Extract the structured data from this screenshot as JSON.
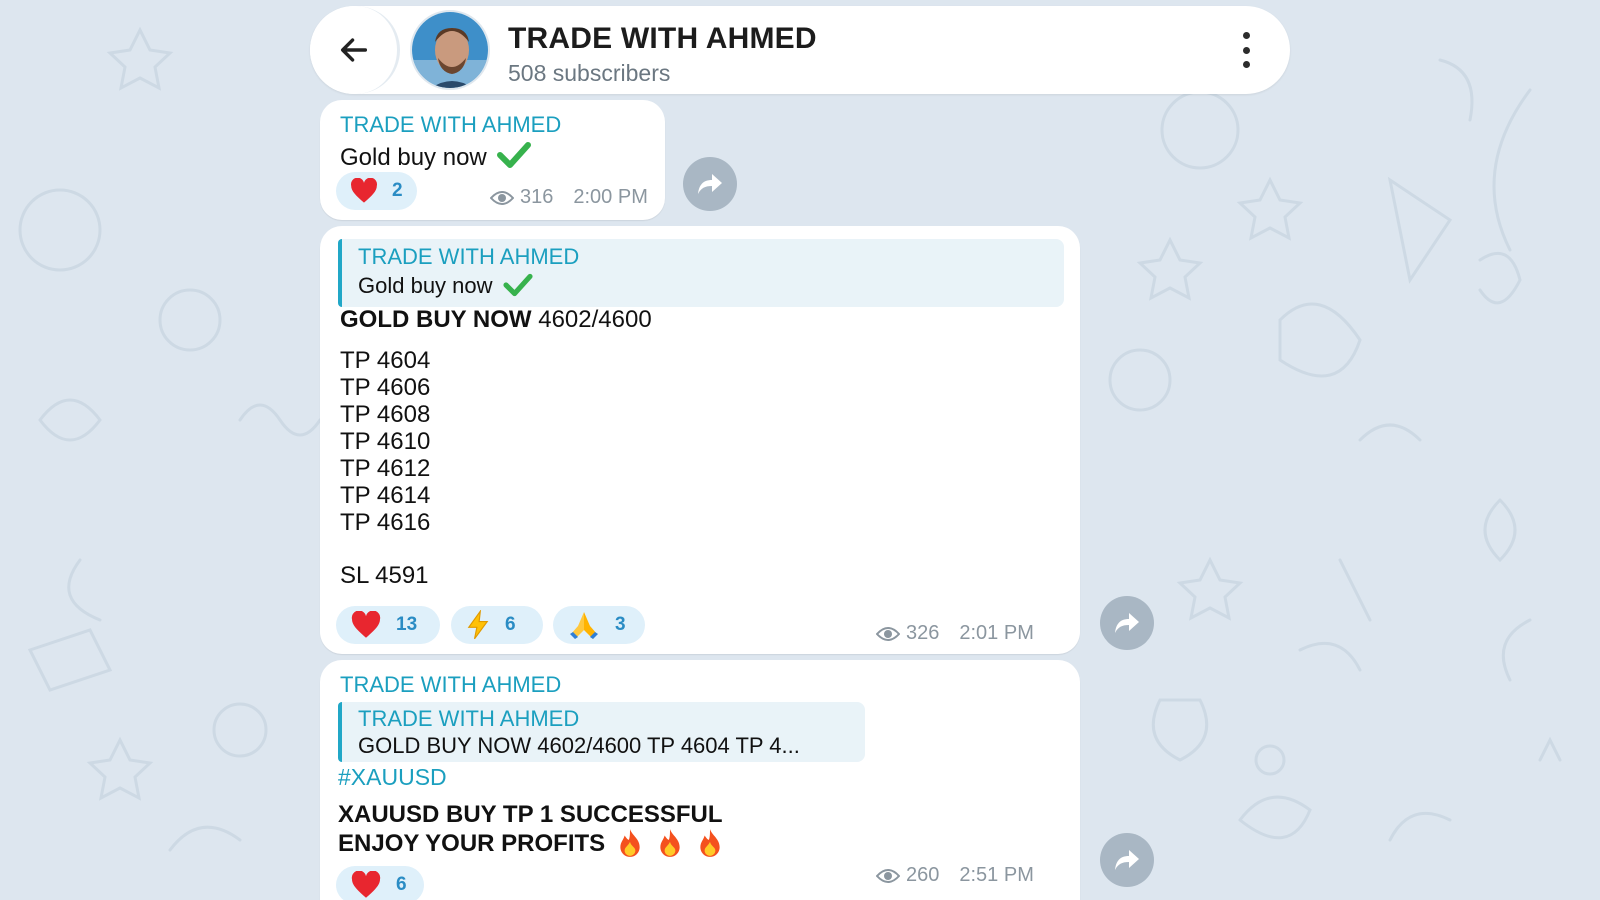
{
  "header": {
    "back_icon": "arrow-left-icon",
    "channel_name": "TRADE WITH AHMED",
    "subscribers": "508 subscribers",
    "menu_icon": "more-vertical-icon"
  },
  "colors": {
    "background": "#dde6ef",
    "accent": "#1b9fbf",
    "reaction_bg": "#dff0fa",
    "share_button": "#a9b7c4"
  },
  "messages": [
    {
      "author": "TRADE WITH AHMED",
      "text": "Gold buy now",
      "text_emoji": "check-mark-icon",
      "reactions": [
        {
          "icon": "heart-icon",
          "count": "2"
        }
      ],
      "views": "316",
      "time": "2:00 PM"
    },
    {
      "quote_author": "TRADE WITH AHMED",
      "quote_text": "Gold buy now",
      "heading_bold": "GOLD BUY NOW",
      "heading_rest": "4602/4600",
      "tps": [
        "TP 4604",
        "TP 4606",
        "TP 4608",
        "TP 4610",
        "TP 4612",
        "TP 4614",
        "TP 4616"
      ],
      "sl": "SL 4591",
      "reactions": [
        {
          "icon": "heart-icon",
          "count": "13"
        },
        {
          "icon": "lightning-icon",
          "count": "6"
        },
        {
          "icon": "praying-hands-icon",
          "count": "3"
        }
      ],
      "views": "326",
      "time": "2:01 PM"
    },
    {
      "author": "TRADE WITH AHMED",
      "quote_author": "TRADE WITH AHMED",
      "quote_text": "GOLD BUY NOW 4602/4600  TP 4604 TP 4...",
      "hashtag": "#XAUUSD",
      "line1": "XAUUSD BUY TP 1 SUCCESSFUL",
      "line2": "ENJOY YOUR PROFITS",
      "line2_emoji": "fire-icon",
      "reactions": [
        {
          "icon": "heart-icon",
          "count": "6"
        }
      ],
      "views": "260",
      "time": "2:51 PM"
    }
  ]
}
